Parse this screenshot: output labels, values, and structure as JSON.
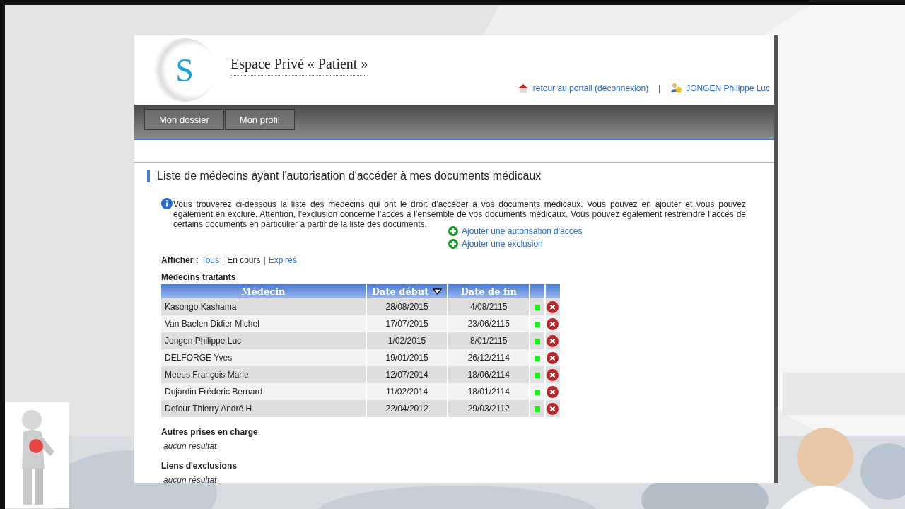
{
  "header": {
    "title": "Espace Privé « Patient »",
    "logo_letter": "S",
    "portal_link": "retour au portail (déconnexion)",
    "separator": "|",
    "user": "JONGEN Philippe Luc"
  },
  "nav": [
    {
      "label": "Mon dossier",
      "selected": false
    },
    {
      "label": "Mon profil",
      "selected": false
    }
  ],
  "page_title": "Liste de médecins ayant l'autorisation d'accéder à mes documents médicaux",
  "info": "Vous trouverez ci-dessous la liste des médecins qui ont le droit d’accéder à vos documents médicaux. Vous pouvez en ajouter et vous pouvez également en exclure. Attention, l’exclusion concerne l’accès à l’ensemble de vos documents médicaux. Vous pouvez également restreindre l’accès de certains documents en particulier à partir de la liste des documents.",
  "actions": [
    "Ajouter une autorisation d'accès",
    "Ajouter une exclusion"
  ],
  "filter": {
    "label": "Afficher :",
    "separator": "|",
    "options": [
      {
        "label": "Tous",
        "selected": false
      },
      {
        "label": "En cours",
        "selected": true
      },
      {
        "label": "Expirés",
        "selected": false
      }
    ]
  },
  "table_title": "Médecins traitants",
  "columns": [
    {
      "label": "Médecin",
      "sorted": false
    },
    {
      "label": "Date début",
      "sorted": true
    },
    {
      "label": "Date de fin",
      "sorted": false
    }
  ],
  "rows": [
    {
      "name": "Kasongo Kashama",
      "start": "28/08/2015",
      "end": "4/08/2115",
      "active": true
    },
    {
      "name": "Van Baelen Didier Michel",
      "start": "17/07/2015",
      "end": "23/06/2115",
      "active": true
    },
    {
      "name": "Jongen Philippe Luc",
      "start": "1/02/2015",
      "end": "8/01/2115",
      "active": true
    },
    {
      "name": "DELFORGE Yves",
      "start": "19/01/2015",
      "end": "26/12/2114",
      "active": true
    },
    {
      "name": "Meeus François Marie",
      "start": "12/07/2014",
      "end": "18/06/2114",
      "active": true
    },
    {
      "name": "Dujardin Fréderic Bernard",
      "start": "11/02/2014",
      "end": "18/01/2114",
      "active": true
    },
    {
      "name": "Defour Thierry André H",
      "start": "22/04/2012",
      "end": "29/03/2112",
      "active": true
    }
  ],
  "sections": [
    {
      "title": "Autres prises en charge",
      "empty": "aucun résultat"
    },
    {
      "title": "Liens d'exclusions",
      "empty": "aucun résultat"
    }
  ]
}
